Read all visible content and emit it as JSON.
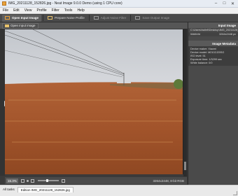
{
  "window": {
    "title": "IMG_20211128_152826.jpg - Neat Image 9.0.0 Demo (using 1 CPU core)",
    "controls": [
      "–",
      "□",
      "✕"
    ]
  },
  "menu": [
    "File",
    "Edit",
    "View",
    "Profile",
    "Filter",
    "Tools",
    "Help"
  ],
  "toolbar": {
    "tabs": [
      {
        "label": "Open Input Image",
        "active": true,
        "icon": "open-image-icon"
      },
      {
        "label": "Prepare Noise Profile",
        "active": false,
        "icon": "profile-icon"
      },
      {
        "label": "Adjust Noise Filter",
        "active": false,
        "icon": "filter-icon"
      },
      {
        "label": "Save Output Image",
        "active": false,
        "icon": "save-icon"
      }
    ]
  },
  "subtoolbar": {
    "open_label": "Open input image"
  },
  "bottombar": {
    "zoom": "15.3%",
    "info": "3264x2448, 8-bit RGB",
    "zoom_level": 0.45
  },
  "sidepanel": {
    "input_header": "Input Image",
    "path": "C:\\Users\\hallell\\Desktop\\IMG_20211128_152826.jpg",
    "width_label": "Width/ht",
    "width_value": "3264x2448 px",
    "metadata_header": "Image Metadata",
    "metadata": [
      "Device maker: Xiaomi",
      "Device model: M2102J20SG",
      "ISO level: 51",
      "Exposure time: 1/3299 sec",
      "White balance: 0/0"
    ]
  },
  "status": {
    "tabs": [
      "All tasks",
      "Edition IMG_20211128_152826.jpg"
    ]
  },
  "colors": {
    "accent": "#e9a23b",
    "panel_bg": "#4a4a4a",
    "sky": "#c9cdd3",
    "ground": "#a85a2d"
  }
}
